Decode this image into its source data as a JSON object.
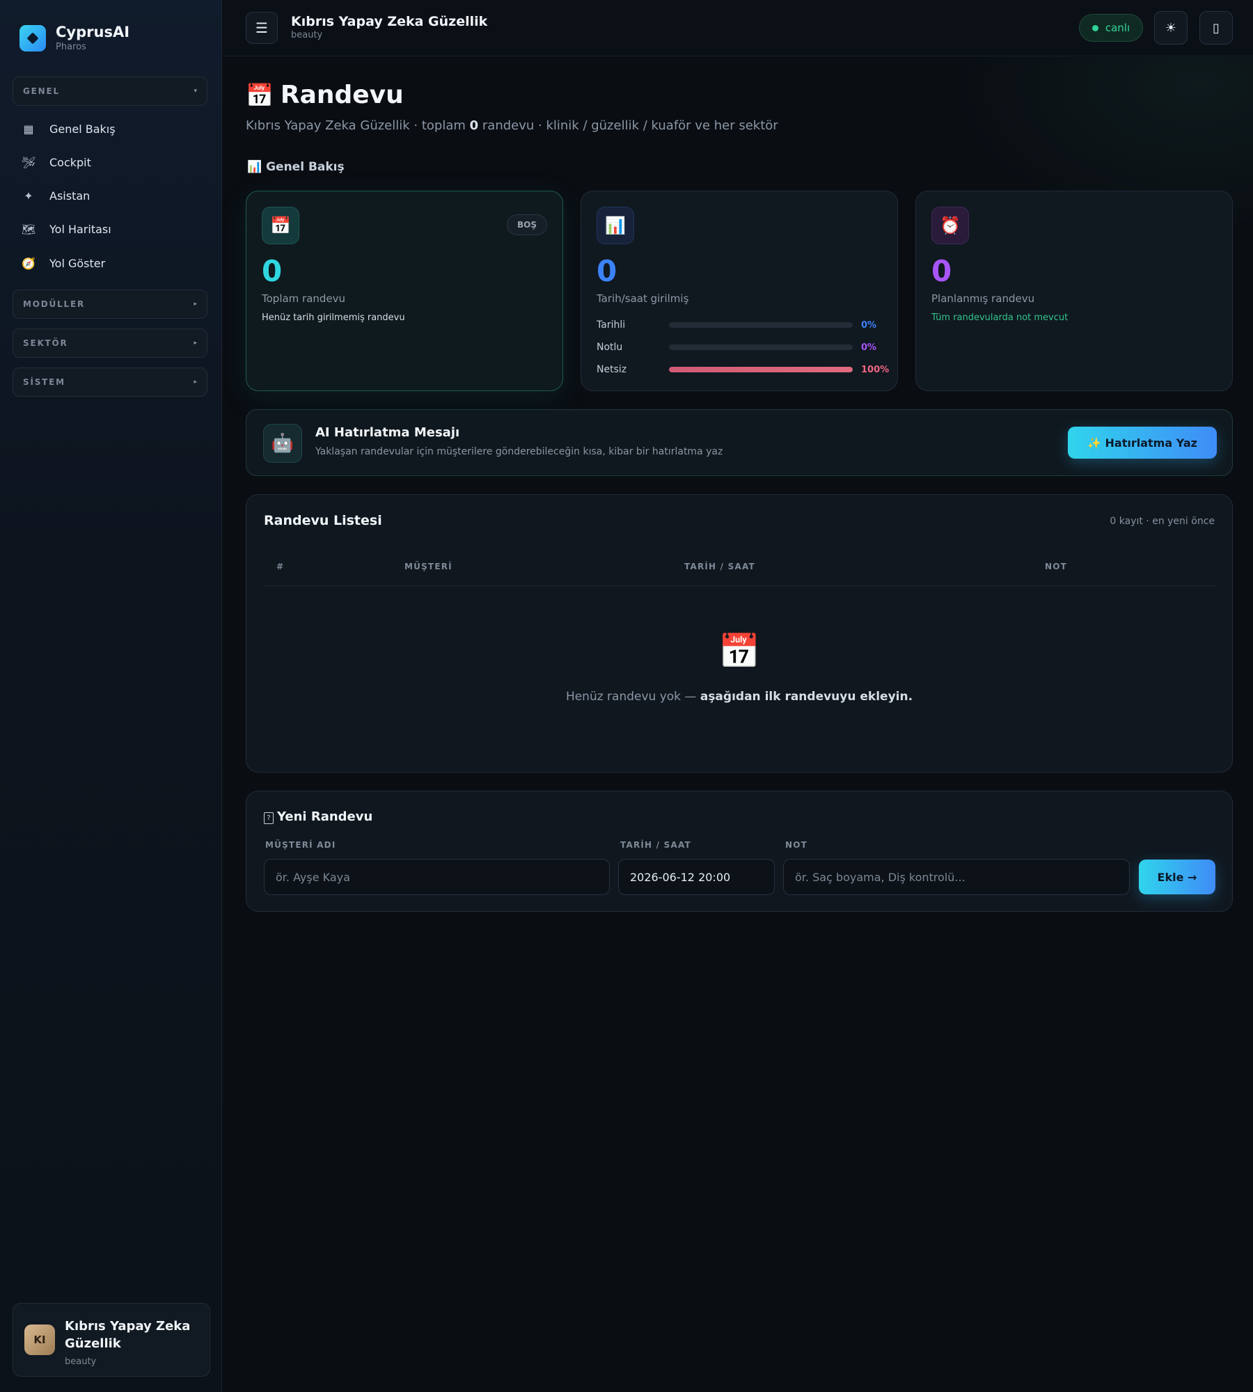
{
  "brand": {
    "name": "CyprusAI",
    "sub": "Pharos"
  },
  "sidebar": {
    "groups": {
      "general": {
        "label": "GENEL",
        "arrow": "▾"
      },
      "modules": {
        "label": "MODÜLLER",
        "arrow": "▸"
      },
      "sector": {
        "label": "SEKTÖR",
        "arrow": "▸"
      },
      "system": {
        "label": "SİSTEM",
        "arrow": "▸"
      }
    },
    "items": [
      {
        "label": "Genel Bakış",
        "icon": "▦"
      },
      {
        "label": "Cockpit",
        "icon": "🛩"
      },
      {
        "label": "Asistan",
        "icon": "✦"
      },
      {
        "label": "Yol Haritası",
        "icon": "🗺"
      },
      {
        "label": "Yol Göster",
        "icon": "🧭"
      }
    ],
    "profile": {
      "initials": "KI",
      "name": "Kıbrıs Yapay Zeka Güzellik",
      "sub": "beauty"
    }
  },
  "topbar": {
    "menu_icon": "☰",
    "title": "Kıbrıs Yapay Zeka Güzellik",
    "sub": "beauty",
    "live_label": "canlı",
    "theme_icon": "☀",
    "phone_icon": "▯"
  },
  "page": {
    "icon": "📅",
    "title": "Randevu",
    "sub_prefix": "Kıbrıs Yapay Zeka Güzellik · toplam ",
    "sub_count": "0",
    "sub_suffix": " randevu · klinik / güzellik / kuaför ve her sektör",
    "overview_label": "📊 Genel Bakış"
  },
  "stats": [
    {
      "icon": "📅",
      "badge": "BOŞ",
      "value": "0",
      "label": "Toplam randevu",
      "note": "Henüz tarih girilmemiş randevu",
      "color": "#2fd6e0"
    },
    {
      "icon": "📊",
      "value": "0",
      "label": "Tarih/saat girilmiş",
      "color": "#3b82f6",
      "bars": [
        {
          "label": "Tarihli",
          "value": "0%",
          "fill": 0,
          "color": "#3b82f6"
        },
        {
          "label": "Notlu",
          "value": "0%",
          "fill": 0,
          "color": "#a855f7"
        },
        {
          "label": "Netsiz",
          "value": "100%",
          "fill": 100,
          "color": "#f06680"
        }
      ]
    },
    {
      "icon": "⏰",
      "value": "0",
      "label": "Planlanmış randevu",
      "note": "Tüm randevularda not mevcut",
      "color": "#a855f7"
    }
  ],
  "ai": {
    "icon": "🤖",
    "title": "AI Hatırlatma Mesajı",
    "desc": "Yaklaşan randevular için müşterilere gönderebileceğin kısa, kibar bir hatırlatma yaz",
    "button": "✨ Hatırlatma Yaz"
  },
  "list": {
    "title": "Randevu Listesi",
    "meta": "0 kayıt · en yeni önce",
    "columns": [
      "#",
      "MÜŞTERİ",
      "TARİH / SAAT",
      "NOT"
    ],
    "empty_icon": "📅",
    "empty_text": "Henüz randevu yok — ",
    "empty_bold": "aşağıdan ilk randevuyu ekleyin."
  },
  "form": {
    "icon": "?",
    "title": "Yeni Randevu",
    "customer_label": "MÜŞTERİ ADI",
    "customer_placeholder": "ör. Ayşe Kaya",
    "datetime_label": "TARİH / SAAT",
    "datetime_value": "2026-06-12 20:00",
    "note_label": "NOT",
    "note_placeholder": "ör. Saç boyama, Diş kontrolü...",
    "add_button": "Ekle →"
  }
}
